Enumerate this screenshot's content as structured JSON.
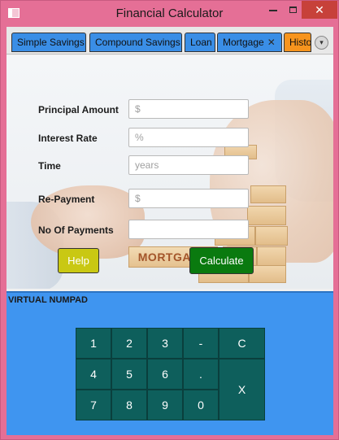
{
  "window": {
    "title": "Financial Calculator",
    "close_glyph": "✕"
  },
  "tabs": [
    {
      "label": "Simple Savings"
    },
    {
      "label": "Compound Savings"
    },
    {
      "label": "Loan"
    },
    {
      "label": "Mortgage",
      "close": "✕"
    },
    {
      "label": "History"
    }
  ],
  "tab_menu_glyph": "▾",
  "form": {
    "principal": {
      "label": "Principal Amount",
      "placeholder": "$",
      "value": ""
    },
    "interest": {
      "label": "Interest Rate",
      "placeholder": "%",
      "value": ""
    },
    "time": {
      "label": "Time",
      "placeholder": "years",
      "value": ""
    },
    "repayment": {
      "label": "Re-Payment",
      "placeholder": "$",
      "value": ""
    },
    "payments": {
      "label": "No Of Payments",
      "placeholder": "",
      "value": ""
    }
  },
  "background_sign": "MORTGAGE",
  "buttons": {
    "help": "Help",
    "calculate": "Calculate"
  },
  "numpad": {
    "title": "VIRTUAL NUMPAD",
    "keys": {
      "k1": "1",
      "k2": "2",
      "k3": "3",
      "minus": "-",
      "clear": "C",
      "k4": "4",
      "k5": "5",
      "k6": "6",
      "dot": ".",
      "k7": "7",
      "k8": "8",
      "k9": "9",
      "k0": "0",
      "backspace": "X"
    }
  },
  "colors": {
    "titlebar": "#e56f96",
    "tab_active": "#3a8ee6",
    "tab_history": "#f7941d",
    "help_button": "#c9c813",
    "calculate_button": "#0a7a0f",
    "numpad_background": "#3f95f0",
    "numpad_key": "#0e5f5c",
    "close_button": "#c7413a"
  }
}
